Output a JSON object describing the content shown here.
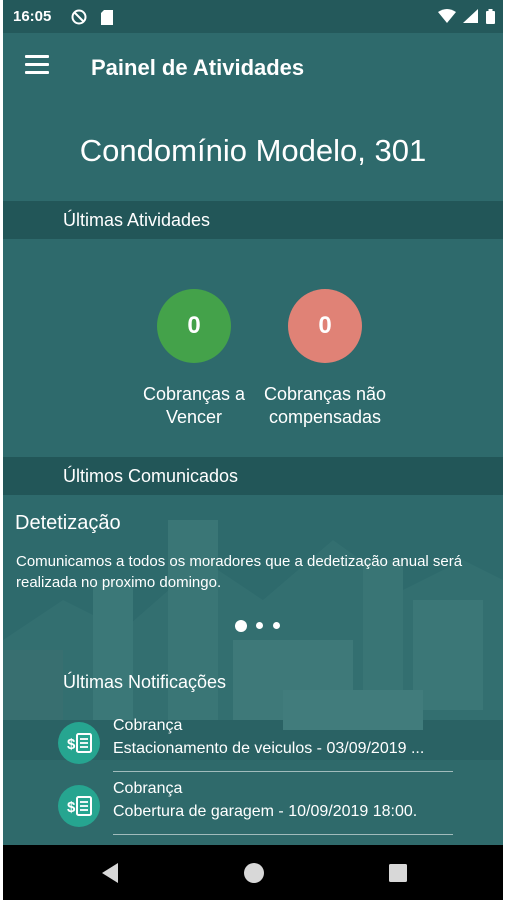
{
  "status_bar": {
    "time": "16:05",
    "left_icons": [
      "settings-status-icon",
      "sd-card-icon"
    ],
    "right_icons": [
      "wifi-icon",
      "signal-icon",
      "battery-icon"
    ]
  },
  "app_bar": {
    "title": "Painel de Atividades",
    "menu_icon": "hamburger-menu-icon"
  },
  "condo_name": "Condomínio Modelo, 301",
  "ultimas_atividades": {
    "header": "Últimas Atividades",
    "items": [
      {
        "count": "0",
        "label_line1": "Cobranças a",
        "label_line2": "Vencer",
        "color": "#44a24a"
      },
      {
        "count": "0",
        "label_line1": "Cobranças não",
        "label_line2": "compensadas",
        "color": "#e08276"
      }
    ]
  },
  "ultimos_comunicados": {
    "header": "Últimos Comunicados",
    "title": "Detetização",
    "text": "Comunicamos a todos os moradores que a dedetização anual será realizada no proximo domingo."
  },
  "ultimas_notificacoes": {
    "header": "Últimas Notificações",
    "items": [
      {
        "title": "Cobrança",
        "text": "Estacionamento de veiculos - 03/09/2019 ...",
        "icon": "billing-icon"
      },
      {
        "title": "Cobrança",
        "text": "Cobertura de garagem - 10/09/2019 18:00.",
        "icon": "billing-icon"
      }
    ]
  },
  "colors": {
    "background": "#2e6a6c",
    "status_bar": "#24595b",
    "notification_icon": "#26a590",
    "nav_bar": "#000000"
  }
}
